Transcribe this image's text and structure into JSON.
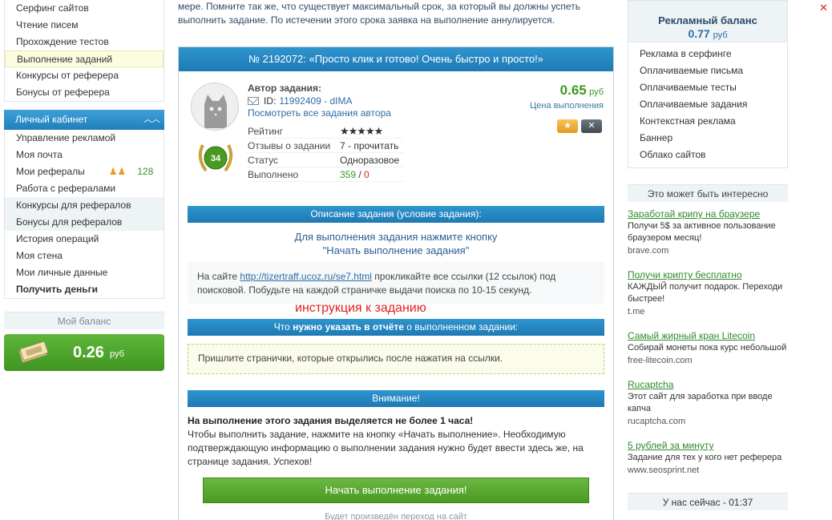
{
  "left_menu_top": [
    {
      "label": "Серфинг сайтов"
    },
    {
      "label": "Чтение писем"
    },
    {
      "label": "Прохождение тестов"
    },
    {
      "label": "Выполнение заданий"
    },
    {
      "label": "Конкурсы от реферера"
    },
    {
      "label": "Бонусы от реферера"
    }
  ],
  "cabinet": {
    "title": "Личный кабинет",
    "items": [
      {
        "label": "Управление рекламой"
      },
      {
        "label": "Моя почта"
      },
      {
        "label": "Мои рефералы",
        "count": "128"
      },
      {
        "label": "Работа с рефералами"
      },
      {
        "label": "Конкурсы для рефералов"
      },
      {
        "label": "Бонусы для рефералов"
      },
      {
        "label": "История операций"
      },
      {
        "label": "Моя стена"
      },
      {
        "label": "Мои личные данные"
      },
      {
        "label": "Получить деньги"
      }
    ]
  },
  "balance": {
    "title": "Мой баланс",
    "value": "0.26",
    "currency": "руб"
  },
  "top_text": "мере. Помните так же, что существует максимальный срок, за который вы должны успеть выполнить задание. По истечении этого срока заявка на выполнение аннулируется.",
  "task": {
    "title": "№ 2192072: «Просто клик и готово! Очень быстро и просто!»",
    "author_label": "Автор задания:",
    "author_id_prefix": "ID:",
    "author_id": "11992409 - dIMA",
    "author_tasks_link": "Посмотреть все задания автора",
    "level": "34",
    "stats": {
      "rating_label": "Рейтинг",
      "rating_stars": "★★★★★",
      "reviews_label": "Отзывы о задании",
      "reviews_value": "7 - прочитать",
      "status_label": "Статус",
      "status_value": "Одноразовое",
      "done_label": "Выполнено",
      "done_value": "359",
      "done_sep": " / ",
      "failed_value": "0"
    },
    "price": {
      "value": "0.65",
      "currency": "руб",
      "label": "Цена выполнения"
    },
    "fav_icon": "star-icon",
    "close_icon": "x-icon",
    "description_bar": "Описание задания (условие задания):",
    "description_title_line1": "Для выполнения задания нажмите кнопку",
    "description_title_line2": "\"Начать выполнение задания\"",
    "description_prefix": "На сайте ",
    "description_link": "http://tizertraff.ucoz.ru/se7.html",
    "description_rest": " прокликайте все ссылки (12 ссылок) под поисковой. Побудьте на каждой страничке выдачи поиска по 10-15 секунд.",
    "instruction_note": "инструкция к заданию",
    "report_bar_prefix": "Что ",
    "report_bar_bold": "нужно указать в отчёте",
    "report_bar_suffix": " о выполненном задании:",
    "report_text": "Пришлите странички, которые открылись после нажатия на ссылки.",
    "attention_bar": "Внимание!",
    "warn_bold": "На выполнение этого задания выделяется не более 1 часа!",
    "warn_text": "Чтобы выполнить задание, нажмите на кнопку «Начать выполнение». Необходимую подтверждающую информацию о выполнении задания нужно будет ввести здесь же, на странице задания. Успехов!",
    "start_button": "Начать выполнение задания!",
    "redirect_note": "Будет произведён переход на сайт"
  },
  "right": {
    "ad_balance_title": "Рекламный баланс",
    "ad_balance_value": "0.77",
    "ad_balance_currency": "руб",
    "menu": [
      {
        "label": "Реклама в серфинге"
      },
      {
        "label": "Оплачиваемые письма"
      },
      {
        "label": "Оплачиваемые тесты"
      },
      {
        "label": "Оплачиваемые задания"
      },
      {
        "label": "Контекстная реклама"
      },
      {
        "label": "Баннер"
      },
      {
        "label": "Облако сайтов"
      }
    ],
    "interest_title": "Это может быть интересно",
    "promos": [
      {
        "title": "Заработай крипу на браузере",
        "desc": "Получи 5$ за активное пользование браузером месяц!",
        "url": "brave.com"
      },
      {
        "title": "Получи крипту бесплатно",
        "desc": "КАЖДЫЙ получит подарок. Переходи быстрее!",
        "url": "t.me"
      },
      {
        "title": "Самый жирный кран Litecoin",
        "desc": "Собирай монеты пока курс небольшой",
        "url": "free-litecoin.com"
      },
      {
        "title": "Rucaptcha",
        "desc": "Этот сайт для заработка при вводе капча",
        "url": "rucaptcha.com"
      },
      {
        "title": "5 рублей за минуту",
        "desc": "Задание для тех у кого нет реферера",
        "url": "www.seosprint.net"
      }
    ],
    "now_label": "У нас сейчас - 01:37"
  },
  "colors": {
    "accent_blue": "#1e79b4",
    "green": "#4a9a22",
    "link": "#2f6ea6",
    "red_note": "#e02020"
  }
}
